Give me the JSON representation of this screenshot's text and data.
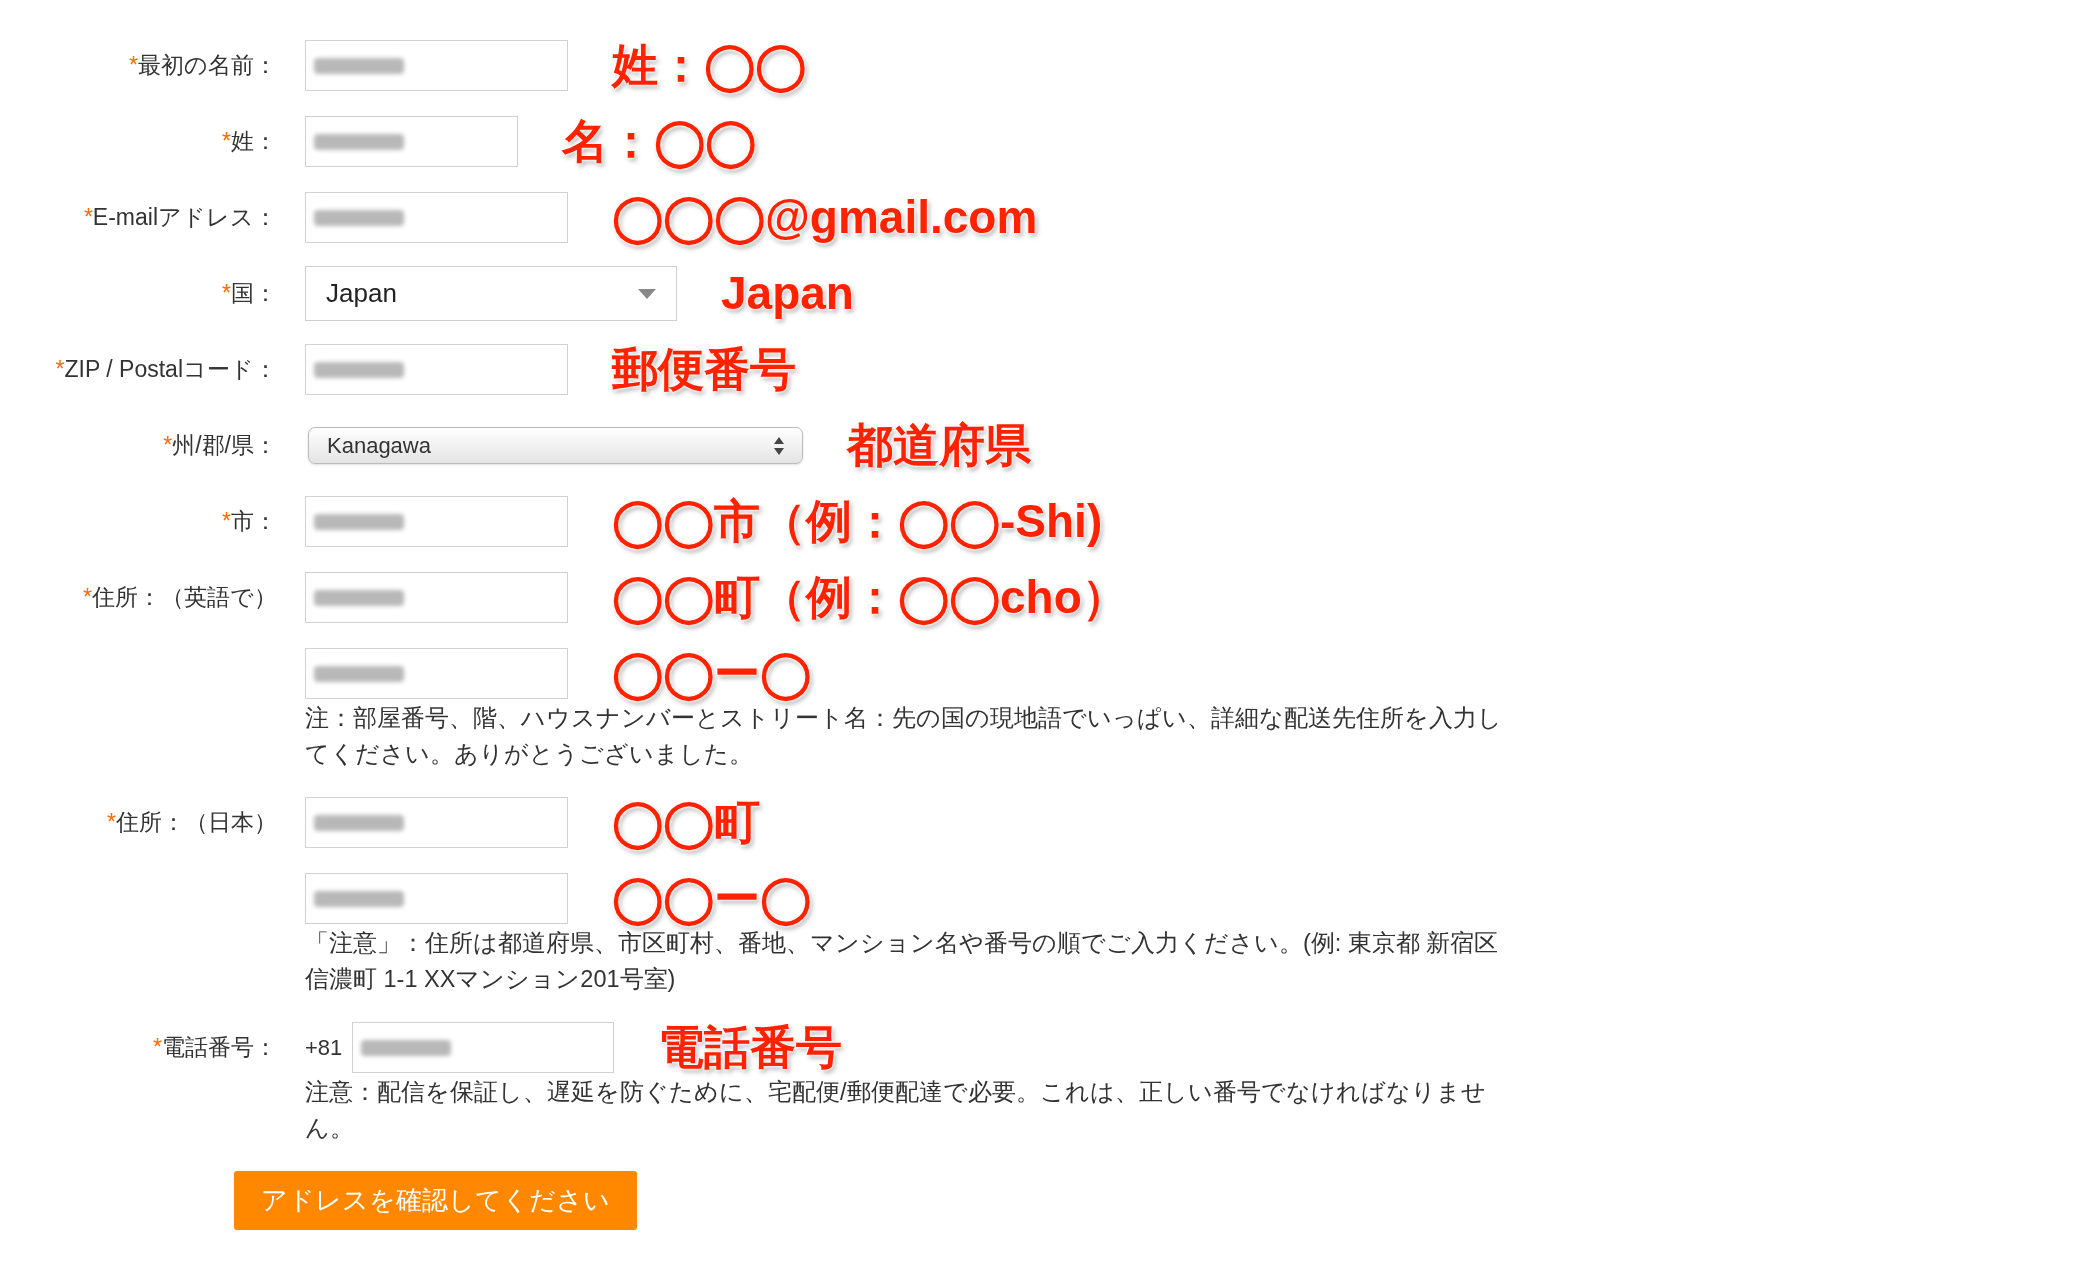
{
  "fields": [
    {
      "kind": "text",
      "mark": "*",
      "label": "最初の名前：",
      "value_hidden": true,
      "annotation": "姓：◯◯"
    },
    {
      "kind": "short_text",
      "mark": "*",
      "label": "姓：",
      "value_hidden": true,
      "annotation": "名：◯◯"
    },
    {
      "kind": "text",
      "mark": "*",
      "label": "E-mailアドレス：",
      "value_hidden": true,
      "annotation": "◯◯◯@gmail.com"
    },
    {
      "kind": "select",
      "mark": "*",
      "label": "国：",
      "value": "Japan",
      "annotation": "Japan"
    },
    {
      "kind": "text",
      "mark": "*",
      "label": "ZIP / Postalコード：",
      "value_hidden": true,
      "annotation": "郵便番号"
    },
    {
      "kind": "stepper_select",
      "mark": "*",
      "label": "州/郡/県：",
      "value": "Kanagawa",
      "annotation": "都道府県"
    },
    {
      "kind": "text",
      "mark": "*",
      "label": "市：",
      "value_hidden": true,
      "annotation": "◯◯市（例：◯◯-Shi)"
    },
    {
      "kind": "text",
      "mark": "*",
      "label": "住所：（英語で）",
      "value_hidden": true,
      "annotation": "◯◯町（例：◯◯cho）"
    },
    {
      "kind": "text",
      "value_hidden": true,
      "annotation": "◯◯ー◯",
      "note": "注：部屋番号、階、ハウスナンバーとストリート名：先の国の現地語でいっぱい、詳細な配送先住所を入力してください。ありがとうございました。"
    },
    {
      "kind": "text",
      "mark": "*",
      "label": "住所：（日本）",
      "value_hidden": true,
      "annotation": "◯◯町"
    },
    {
      "kind": "text",
      "value_hidden": true,
      "annotation": "◯◯ー◯",
      "note": "「注意」：住所は都道府県、市区町村、番地、マンション名や番号の順でご入力ください。(例: 東京都 新宿区信濃町 1-1 XXマンション201号室)"
    },
    {
      "kind": "phone",
      "mark": "*",
      "label": "電話番号：",
      "prefix": "+81",
      "value_hidden": true,
      "annotation": "電話番号",
      "note": "注意：配信を保証し、遅延を防ぐために、宅配便/郵便配達で必要。これは、正しい番号でなければなりません。"
    }
  ],
  "submit_button": "アドレスを確認してください"
}
